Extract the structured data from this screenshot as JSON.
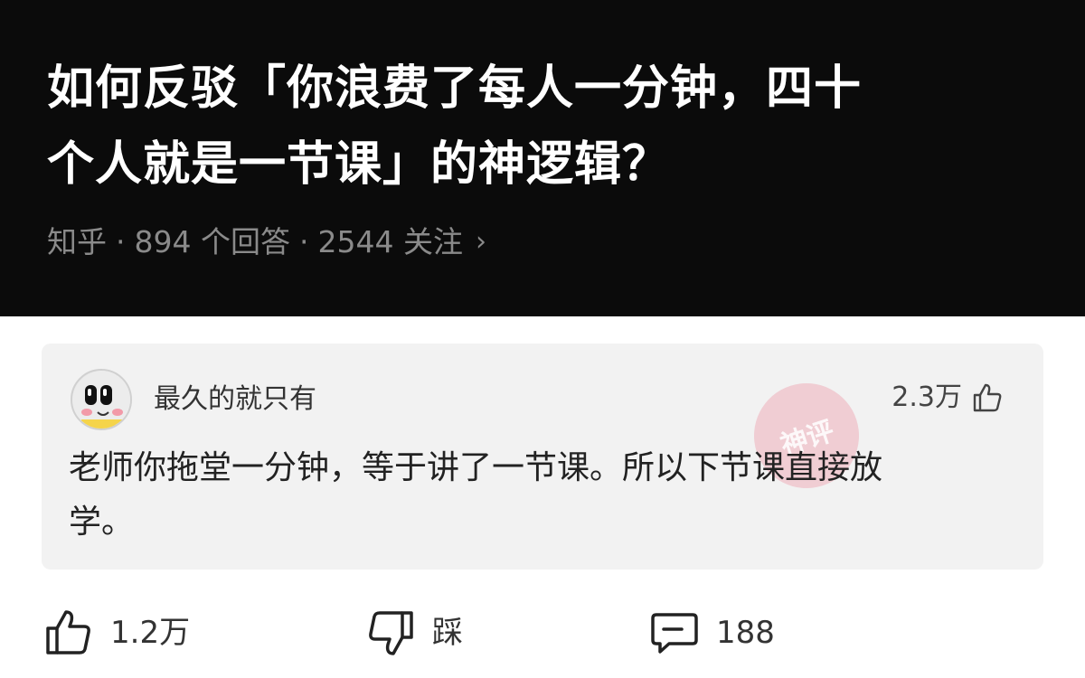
{
  "question": {
    "title_line1": "如何反驳「你浪费了每人一分钟，四十",
    "title_line2": "个人就是一节课」的神逻辑？",
    "source": "知乎",
    "answers": "894 个回答",
    "followers": "2544 关注",
    "chevron": "›"
  },
  "answer_card": {
    "author": "最久的就只有",
    "likes": "2.3万",
    "text_line1": "老师你拖堂一分钟，等于讲了一节课。所以下节课直接放",
    "text_line2": "学。",
    "watermark": "神评"
  },
  "actions": {
    "upvote_count": "1.2万",
    "downvote_label": "踩",
    "comment_count": "188"
  },
  "colors": {
    "header_bg": "#0b0b0b",
    "title_text": "#ffffff",
    "meta_text": "#8a8a8a",
    "card_bg": "#f2f2f2",
    "stamp_pink": "#ec788c"
  },
  "icons": [
    "thumbs-up-icon",
    "thumbs-down-icon",
    "comment-icon",
    "chevron-right-icon"
  ]
}
